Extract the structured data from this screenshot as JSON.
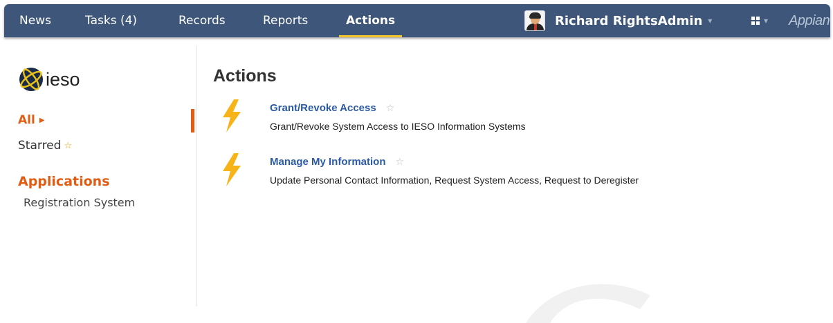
{
  "nav": {
    "tabs": [
      {
        "label": "News"
      },
      {
        "label": "Tasks (4)"
      },
      {
        "label": "Records"
      },
      {
        "label": "Reports"
      },
      {
        "label": "Actions",
        "active": true
      }
    ],
    "user_name": "Richard RightsAdmin",
    "brand": "Appian",
    "icons": {
      "user_menu": "chevron-down-icon",
      "apps_grid": "grid-icon",
      "avatar": "user-avatar"
    }
  },
  "sidebar": {
    "logo_text": "ieso",
    "filter_all": "All",
    "filter_starred": "Starred",
    "applications_heading": "Applications",
    "applications": [
      "Registration System"
    ]
  },
  "main": {
    "title": "Actions",
    "actions": [
      {
        "title": "Grant/Revoke Access",
        "description": "Grant/Revoke System Access to IESO Information Systems"
      },
      {
        "title": "Manage My Information",
        "description": "Update Personal Contact Information, Request System Access, Request to Deregister"
      }
    ]
  },
  "colors": {
    "nav_bg": "#3d5679",
    "nav_active_underline": "#f3c52a",
    "accent_orange": "#e05d13",
    "link_blue": "#2b5aa5",
    "bolt_yellow": "#f7b418"
  }
}
